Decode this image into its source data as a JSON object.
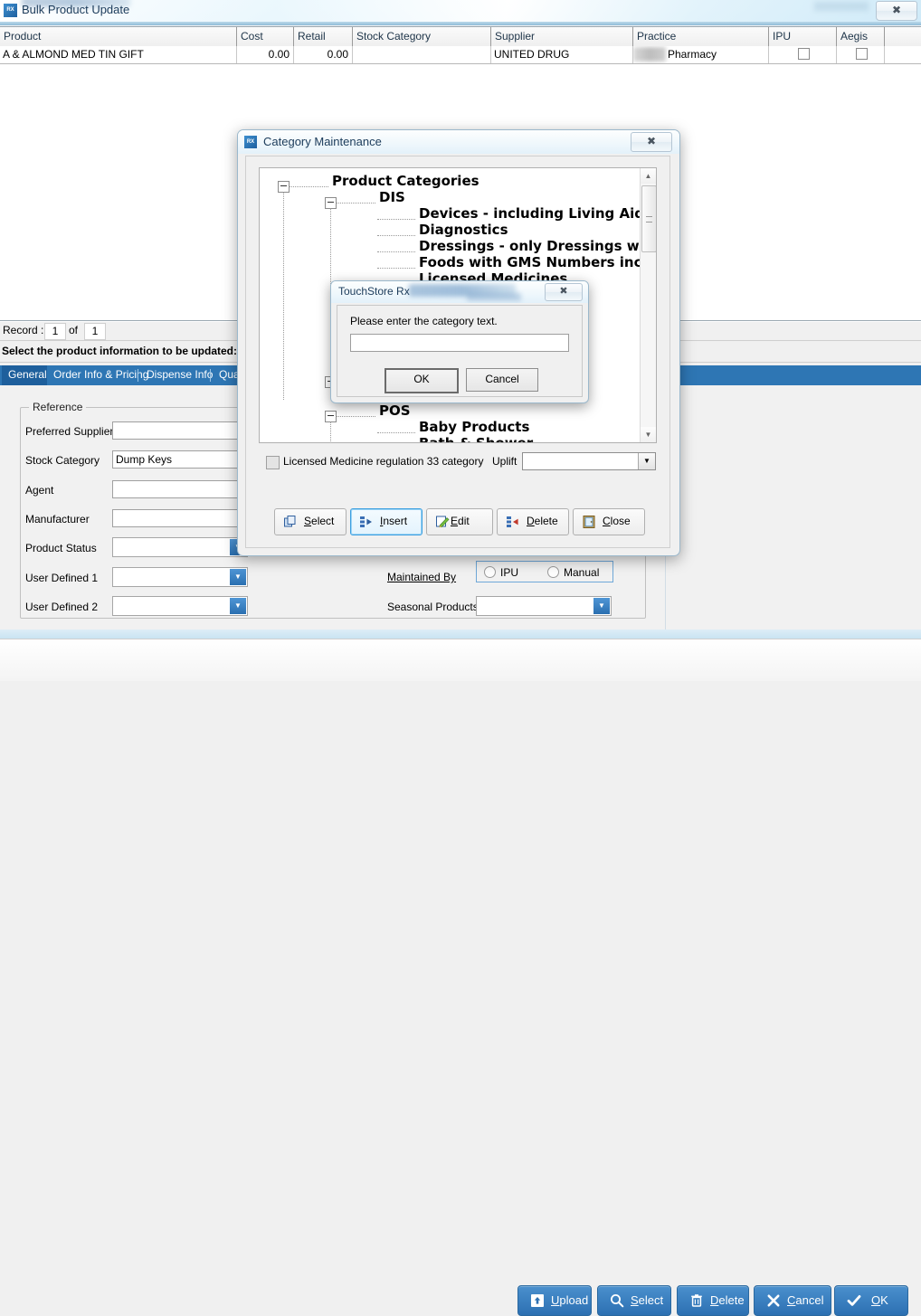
{
  "window": {
    "title": "Bulk Product Update",
    "icon": "rx-icon",
    "close_label": "✖"
  },
  "grid": {
    "columns": [
      "Product",
      "Cost",
      "Retail",
      "Stock Category",
      "Supplier",
      "Practice",
      "IPU",
      "Aegis"
    ],
    "rows": [
      {
        "product": "A & ALMOND MED TIN GIFT",
        "cost": "0.00",
        "retail": "0.00",
        "stock_category": "",
        "supplier": "UNITED DRUG",
        "practice": "Pharmacy",
        "ipu_checked": false,
        "aegis_checked": false
      }
    ]
  },
  "record_bar": {
    "label": "Record :",
    "current": "1",
    "of": "of",
    "total": "1"
  },
  "instruction": "Select the product information to be updated:",
  "tabs": [
    {
      "label": "General",
      "active": true
    },
    {
      "label": "Order Info & Pricing",
      "active": false
    },
    {
      "label": "Dispense Info",
      "active": false
    },
    {
      "label": "Quan",
      "active": false
    }
  ],
  "form": {
    "groupbox_title": "Reference",
    "fields": [
      {
        "label": "Preferred Supplier",
        "value": "",
        "type": "text"
      },
      {
        "label": "Stock Category",
        "value": "Dump Keys",
        "type": "text"
      },
      {
        "label": "Agent",
        "value": "",
        "type": "text"
      },
      {
        "label": "Manufacturer",
        "value": "",
        "type": "text"
      },
      {
        "label": "Product Status",
        "value": "",
        "type": "combo"
      },
      {
        "label": "User Defined 1",
        "value": "",
        "type": "combo"
      },
      {
        "label": "User Defined 2",
        "value": "",
        "type": "combo"
      }
    ],
    "maintained_by": {
      "label": "Maintained By",
      "options": [
        "IPU",
        "Manual"
      ],
      "selected": ""
    },
    "seasonal_products": {
      "label": "Seasonal Products",
      "value": ""
    }
  },
  "bottom_toolbar": [
    {
      "label": "Upload",
      "icon": "upload-icon",
      "accel": "U"
    },
    {
      "label": "Select",
      "icon": "search-icon",
      "accel": "S"
    },
    {
      "label": "Delete",
      "icon": "trash-icon",
      "accel": "D"
    },
    {
      "label": "Cancel",
      "icon": "x-icon",
      "accel": "C"
    },
    {
      "label": "OK",
      "icon": "check-icon",
      "accel": "O"
    }
  ],
  "category_dialog": {
    "title": "Category Maintenance",
    "icon": "rx-icon",
    "close_label": "✖",
    "tree": {
      "root": "Product Categories",
      "groups": [
        {
          "name": "DIS",
          "items": [
            "Devices - including Living Aid",
            "Diagnostics",
            "Dressings - only Dressings wit",
            "Foods with GMS Numbers includi",
            "Licensed Medicines"
          ]
        },
        {
          "name": "POS",
          "items": [
            "Baby Products",
            "Bath & Shower"
          ]
        }
      ]
    },
    "licensed_checkbox": {
      "label": "Licensed Medicine regulation 33 category",
      "checked": false
    },
    "uplift": {
      "label": "Uplift",
      "value": ""
    },
    "buttons": [
      {
        "label": "Select",
        "accel": "S",
        "icon": "copy-icon",
        "focused": false
      },
      {
        "label": "Insert",
        "accel": "I",
        "icon": "insert-icon",
        "focused": true
      },
      {
        "label": "Edit",
        "accel": "E",
        "icon": "pencil-icon",
        "focused": false
      },
      {
        "label": "Delete",
        "accel": "D",
        "icon": "delete-icon",
        "focused": false
      },
      {
        "label": "Close",
        "accel": "C",
        "icon": "door-icon",
        "focused": false
      }
    ]
  },
  "prompt_dialog": {
    "title": "TouchStore Rx",
    "close_label": "✖",
    "message": "Please enter the category text.",
    "input_value": "",
    "ok_label": "OK",
    "cancel_label": "Cancel"
  },
  "colors": {
    "accent_blue": "#2e76b4",
    "tab_active": "#1e5f9c",
    "button_blue": "#3a83c2",
    "panel_bg": "#f1f1f1"
  }
}
